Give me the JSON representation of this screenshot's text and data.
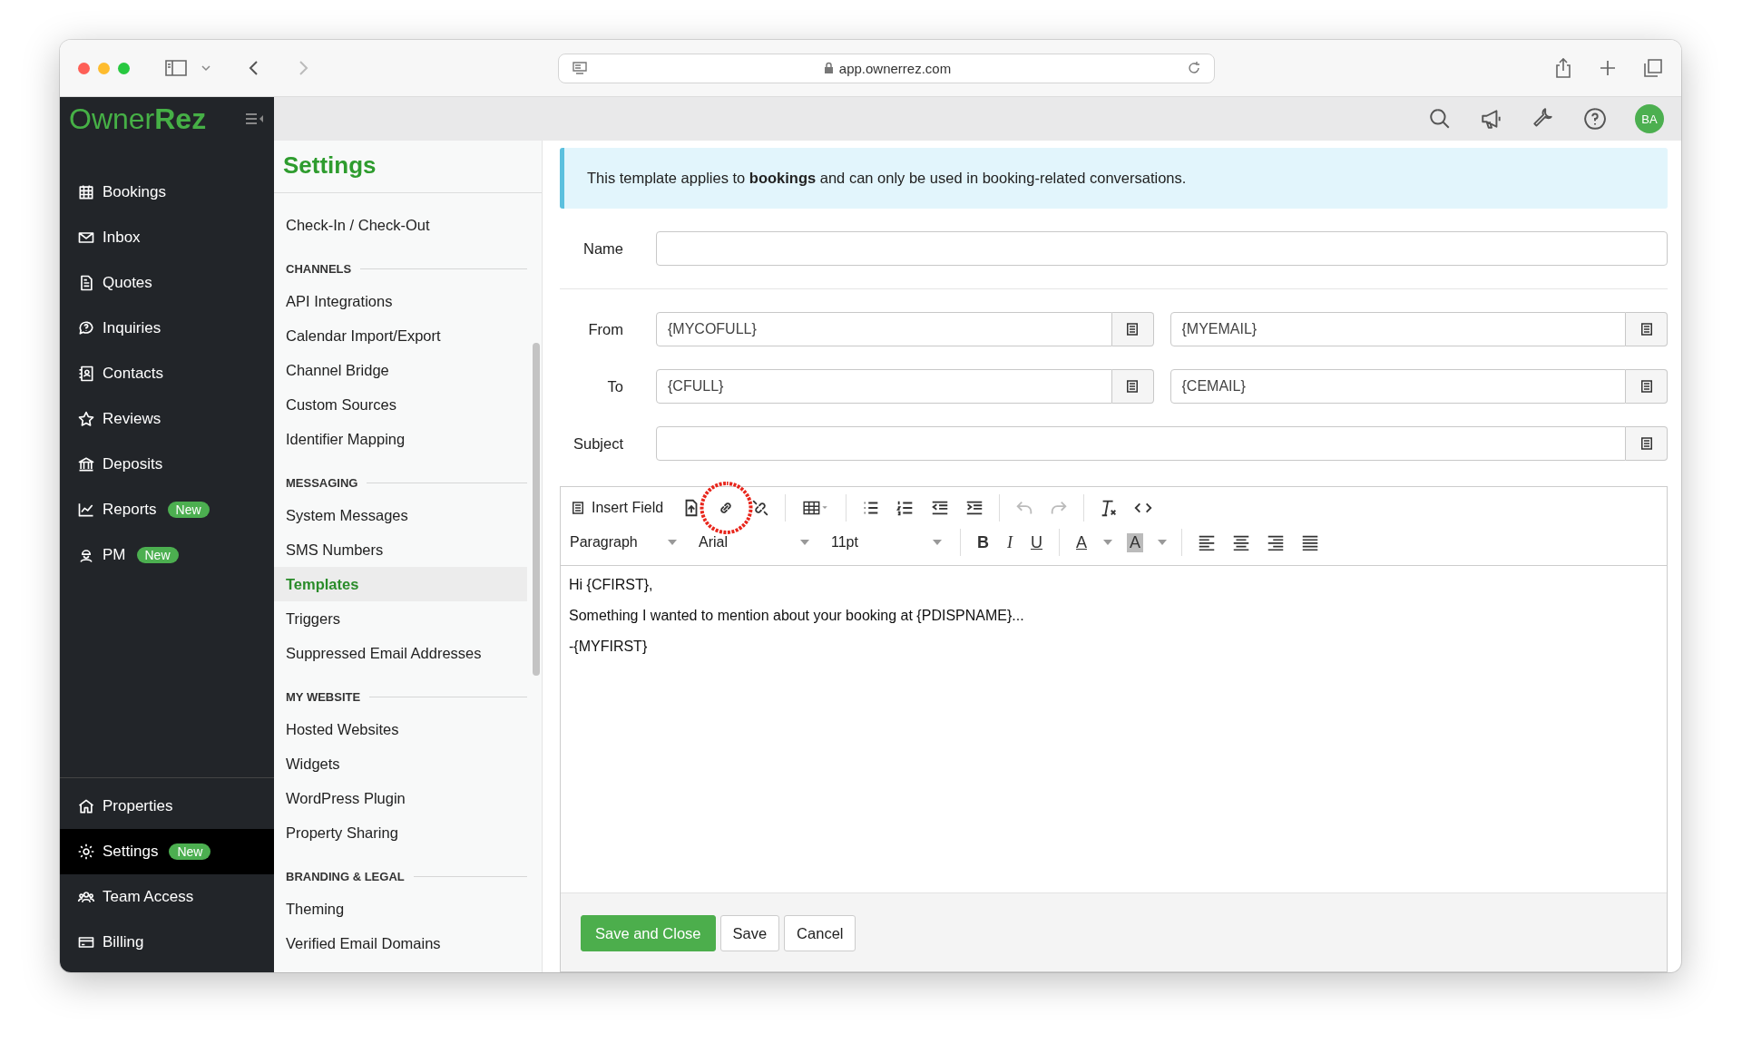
{
  "browser": {
    "url": "app.ownerrez.com",
    "forward_disabled": true
  },
  "sidebar": {
    "logo": "Owner**Rez**",
    "items": [
      {
        "label": "Bookings",
        "selected": false
      },
      {
        "label": "Inbox",
        "selected": false
      },
      {
        "label": "Quotes",
        "selected": false
      },
      {
        "label": "Inquiries",
        "selected": false
      },
      {
        "label": "Contacts",
        "selected": false
      },
      {
        "label": "Reviews",
        "selected": false
      },
      {
        "label": "Deposits",
        "selected": false
      },
      {
        "label": "Reports",
        "selected": false,
        "badge": "New"
      },
      {
        "label": "PM",
        "selected": false,
        "badge": "New"
      }
    ],
    "bottom_items": [
      {
        "label": "Properties",
        "selected": false
      },
      {
        "label": "Settings",
        "selected": true,
        "badge": "New"
      },
      {
        "label": "Team Access",
        "selected": false
      },
      {
        "label": "Billing",
        "selected": false
      }
    ]
  },
  "topbar": {
    "avatar": "BA"
  },
  "settings_menu": {
    "title": "Settings",
    "sections": [
      {
        "items": [
          {
            "label": "Check-In / Check-Out",
            "selected": false
          }
        ]
      },
      {
        "heading": "CHANNELS",
        "items": [
          {
            "label": "API Integrations",
            "selected": false
          },
          {
            "label": "Calendar Import/Export",
            "selected": false
          },
          {
            "label": "Channel Bridge",
            "selected": false
          },
          {
            "label": "Custom Sources",
            "selected": false
          },
          {
            "label": "Identifier Mapping",
            "selected": false
          }
        ]
      },
      {
        "heading": "MESSAGING",
        "items": [
          {
            "label": "System Messages",
            "selected": false
          },
          {
            "label": "SMS Numbers",
            "selected": false
          },
          {
            "label": "Templates",
            "selected": true
          },
          {
            "label": "Triggers",
            "selected": false
          },
          {
            "label": "Suppressed Email Addresses",
            "selected": false
          }
        ]
      },
      {
        "heading": "MY WEBSITE",
        "items": [
          {
            "label": "Hosted Websites",
            "selected": false
          },
          {
            "label": "Widgets",
            "selected": false
          },
          {
            "label": "WordPress Plugin",
            "selected": false
          },
          {
            "label": "Property Sharing",
            "selected": false
          }
        ]
      },
      {
        "heading": "BRANDING & LEGAL",
        "items": [
          {
            "label": "Theming",
            "selected": false
          },
          {
            "label": "Verified Email Domains",
            "selected": false
          }
        ]
      }
    ]
  },
  "notice": "This template applies to **bookings** and can only be used in booking-related conversations.",
  "form": {
    "name": {
      "label": "Name"
    },
    "from": {
      "label": "From",
      "fields": [
        {
          "value": "{MYCOFULL}"
        },
        {
          "value": "{MYEMAIL}"
        }
      ]
    },
    "to": {
      "label": "To",
      "fields": [
        {
          "value": "{CFULL}"
        },
        {
          "value": "{CEMAIL}"
        }
      ]
    },
    "subject": {
      "label": "Subject"
    }
  },
  "editor": {
    "insert_field": "Insert Field",
    "undo": {
      "disabled": true
    },
    "redo": {
      "disabled": true
    },
    "block_format": "Paragraph",
    "font": "Arial",
    "size": "11pt",
    "format_buttons": [
      "B",
      "I",
      "U"
    ],
    "text_color": "A",
    "highlight_color": "A",
    "body": [
      "Hi {CFIRST},",
      "Something I wanted to mention about your booking at {PDISPNAME}...",
      "-{MYFIRST}"
    ]
  },
  "buttons": [
    {
      "label": "Save and Close",
      "kind": "primary"
    },
    {
      "label": "Save",
      "kind": "default"
    },
    {
      "label": "Cancel",
      "kind": "default"
    }
  ]
}
